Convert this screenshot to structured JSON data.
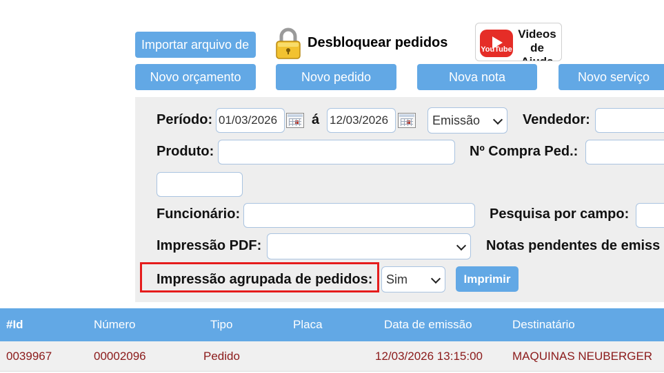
{
  "toolbar": {
    "import_label": "Importar arquivo de",
    "unlock_label": "Desbloquear pedidos",
    "videos_label_line1": "Videos",
    "videos_label_line2": "de Ajuda",
    "youtube_word": "YouTube",
    "new_quote_label": "Novo orçamento",
    "new_order_label": "Novo pedido",
    "new_invoice_label": "Nova nota",
    "new_service_label": "Novo serviço"
  },
  "filters": {
    "period_label": "Período:",
    "date_from": "01/03/2026",
    "between_label": "á",
    "date_to": "12/03/2026",
    "date_type_selected": "Emissão",
    "seller_label": "Vendedor:",
    "product_label": "Produto:",
    "purchase_order_label": "Nº Compra Ped.:",
    "employee_label": "Funcionário:",
    "field_search_label": "Pesquisa por campo:",
    "pdf_print_label": "Impressão PDF:",
    "pdf_print_selected": "",
    "pending_notes_label": "Notas pendentes de emiss",
    "grouped_print_label": "Impressão agrupada de pedidos:",
    "grouped_print_selected": "Sim",
    "print_button": "Imprimir"
  },
  "table": {
    "columns": [
      "#Id",
      "Número",
      "Tipo",
      "Placa",
      "Data de emissão",
      "Destinatário"
    ],
    "rows": [
      {
        "id": "0039967",
        "number": "00002096",
        "type": "Pedido",
        "plate": "",
        "issue_date": "12/03/2026 13:15:00",
        "recipient": "MAQUINAS NEUBERGER"
      }
    ]
  },
  "colors": {
    "accent": "#62a8e5",
    "highlight_border": "#e51c1c",
    "row_text": "#8b1a1a",
    "panel_bg": "#eeeeee"
  }
}
